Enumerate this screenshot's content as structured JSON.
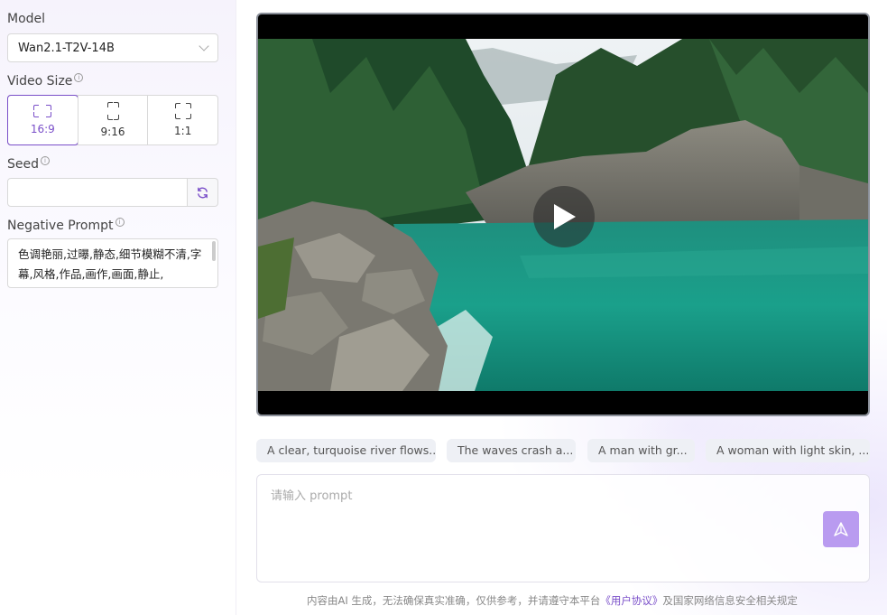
{
  "sidebar": {
    "model_label": "Model",
    "model_value": "Wan2.1-T2V-14B",
    "video_size_label": "Video Size",
    "video_sizes": [
      {
        "label": "16:9",
        "icon": "landscape-frame-icon",
        "selected": true
      },
      {
        "label": "9:16",
        "icon": "portrait-frame-icon",
        "selected": false
      },
      {
        "label": "1:1",
        "icon": "square-frame-icon",
        "selected": false
      }
    ],
    "seed_label": "Seed",
    "seed_value": "",
    "negative_prompt_label": "Negative Prompt",
    "negative_prompt_value": "色调艳丽,过曝,静态,细节模糊不清,字幕,风格,作品,画作,画面,静止,"
  },
  "video": {
    "play_icon": "play-icon"
  },
  "suggestions": [
    "A clear, turquoise river flows...",
    "The waves crash a...",
    "A man with gr...",
    "A woman with light skin, ..."
  ],
  "prompt": {
    "placeholder": "请输入 prompt",
    "send_icon": "send-icon"
  },
  "footer": {
    "prefix": "内容由AI 生成，无法确保真实准确，仅供参考，并请遵守本平台",
    "link": "《用户协议》",
    "suffix": "及国家网络信息安全相关规定"
  },
  "colors": {
    "accent": "#7a4fc9",
    "send_button": "#b99bf0"
  }
}
